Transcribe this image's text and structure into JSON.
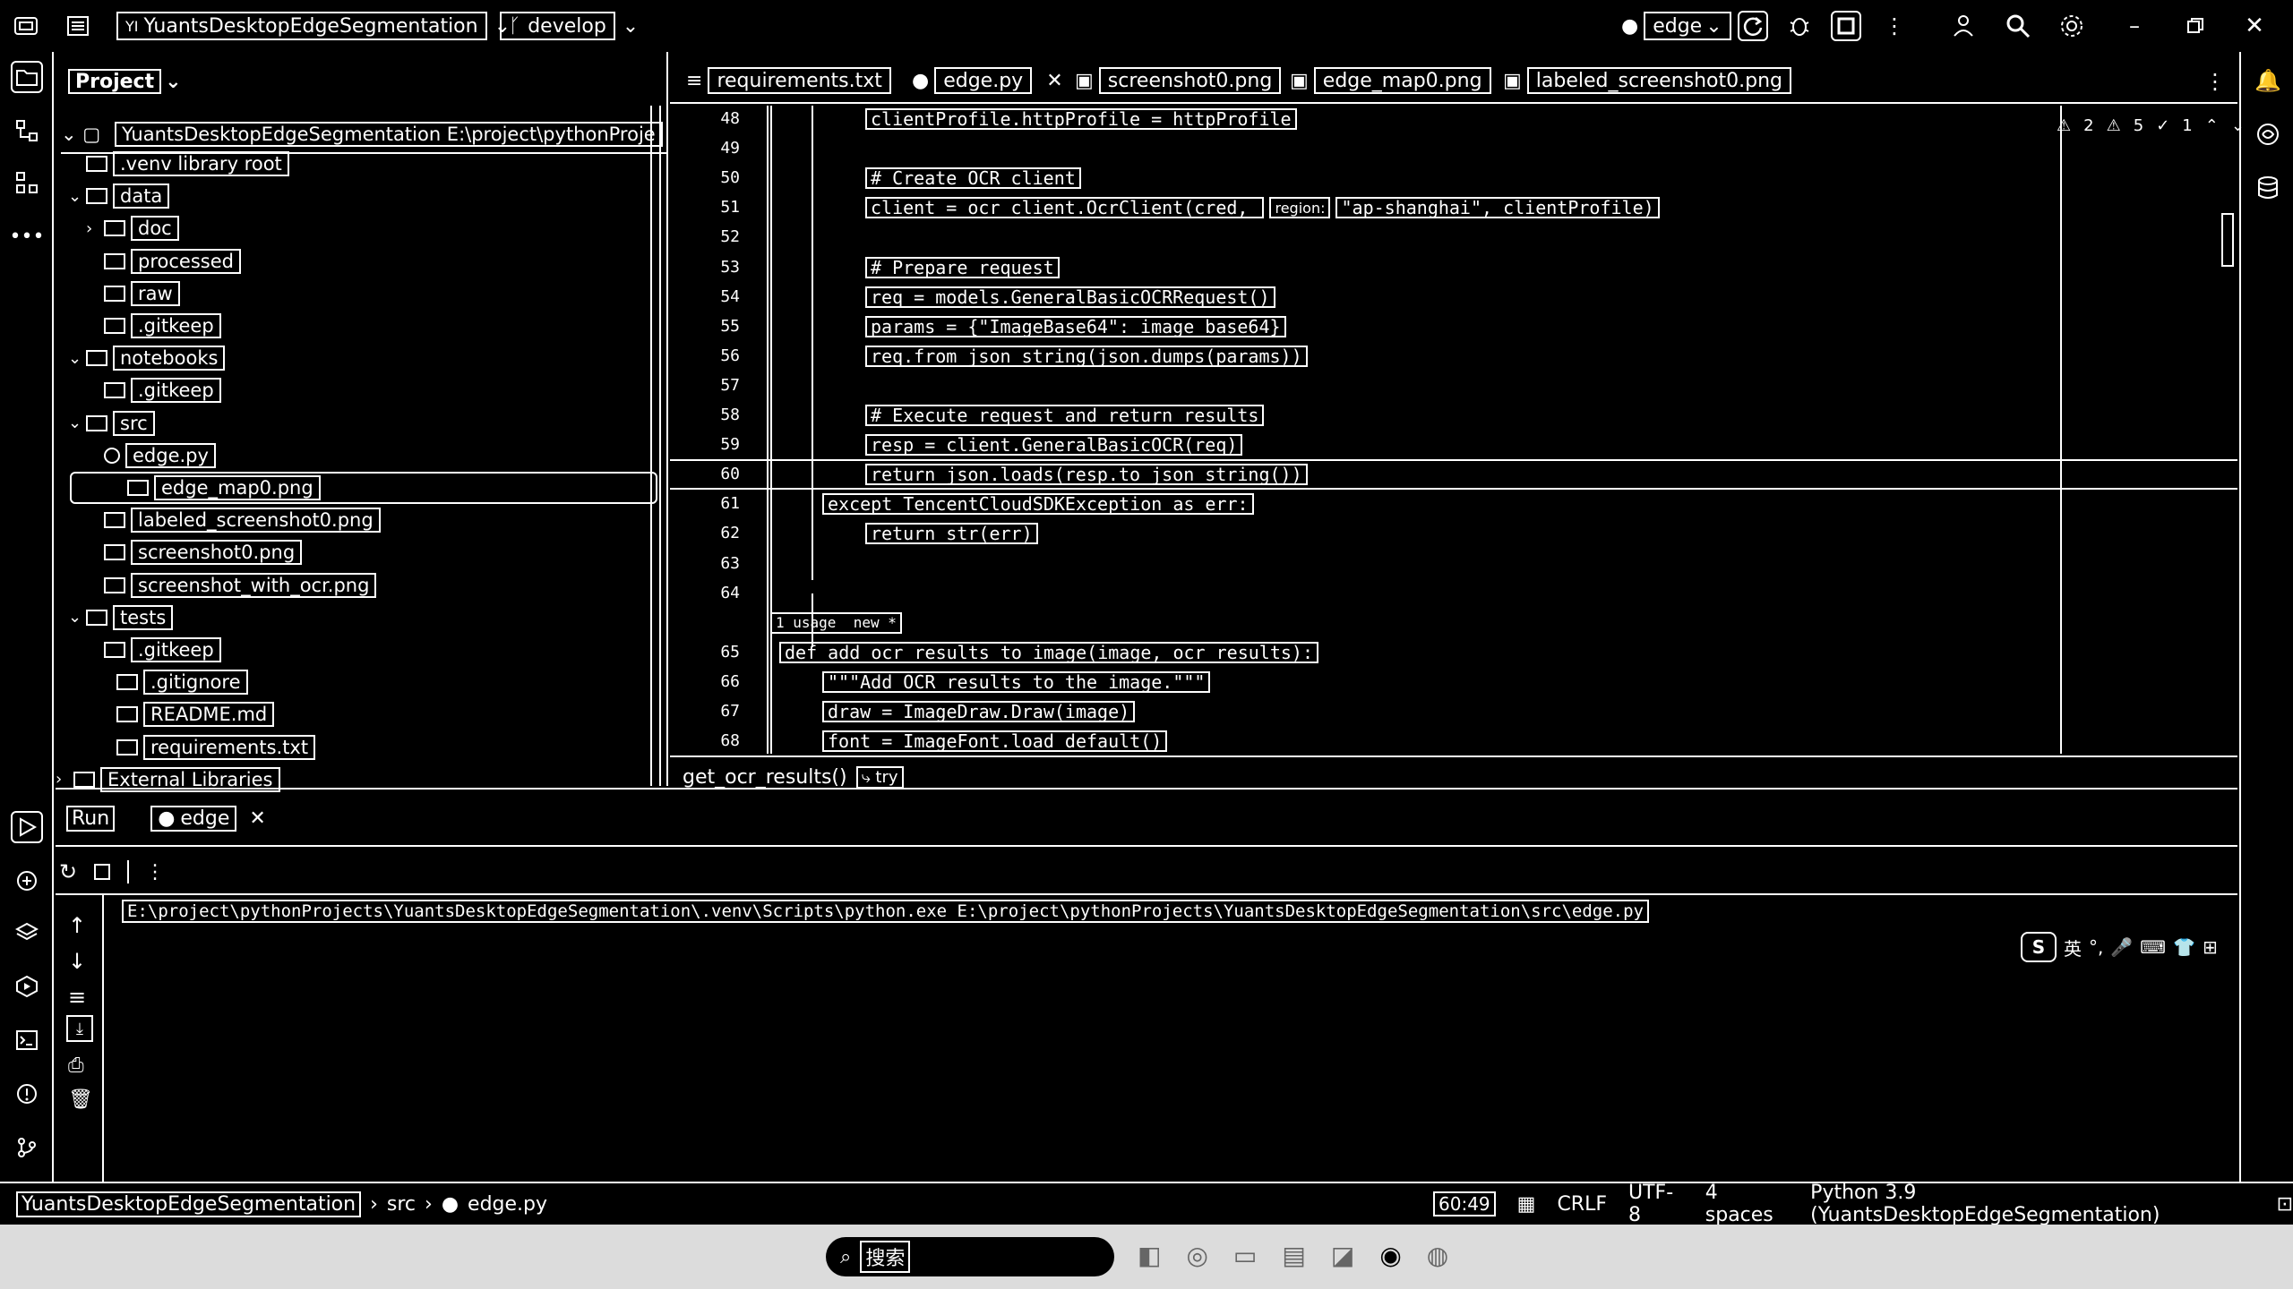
{
  "titlebar": {
    "project_name": "YuantsDesktopEdgeSegmentation",
    "branch": "develop",
    "run_config": "edge"
  },
  "project_panel": {
    "title": "Project",
    "root_label": "YuantsDesktopEdgeSegmentation  E:\\project\\pythonProje",
    "items": [
      {
        "label": ".venv  library root",
        "indent": 0,
        "chev": "",
        "kind": "folder"
      },
      {
        "label": "data",
        "indent": 0,
        "chev": "v",
        "kind": "folder"
      },
      {
        "label": "doc",
        "indent": 1,
        "chev": ">",
        "kind": "folder"
      },
      {
        "label": "processed",
        "indent": 1,
        "chev": "",
        "kind": "folder"
      },
      {
        "label": "raw",
        "indent": 1,
        "chev": "",
        "kind": "folder"
      },
      {
        "label": ".gitkeep",
        "indent": 1,
        "chev": "",
        "kind": "file"
      },
      {
        "label": "notebooks",
        "indent": 0,
        "chev": "v",
        "kind": "folder"
      },
      {
        "label": ".gitkeep",
        "indent": 1,
        "chev": "",
        "kind": "file"
      },
      {
        "label": "src",
        "indent": 0,
        "chev": "v",
        "kind": "folder"
      },
      {
        "label": "edge.py",
        "indent": 1,
        "chev": "",
        "kind": "py"
      },
      {
        "label": "edge_map0.png",
        "indent": 1,
        "chev": "",
        "kind": "img",
        "selected": true
      },
      {
        "label": "labeled_screenshot0.png",
        "indent": 1,
        "chev": "",
        "kind": "img"
      },
      {
        "label": "screenshot0.png",
        "indent": 1,
        "chev": "",
        "kind": "img"
      },
      {
        "label": "screenshot_with_ocr.png",
        "indent": 1,
        "chev": "",
        "kind": "img"
      },
      {
        "label": "tests",
        "indent": 0,
        "chev": "v",
        "kind": "folder"
      },
      {
        "label": ".gitkeep",
        "indent": 1,
        "chev": "",
        "kind": "file"
      },
      {
        "label": ".gitignore",
        "indent": -1,
        "chev": "",
        "kind": "file"
      },
      {
        "label": "README.md",
        "indent": -1,
        "chev": "",
        "kind": "file"
      },
      {
        "label": "requirements.txt",
        "indent": -1,
        "chev": "",
        "kind": "file"
      },
      {
        "label": "External Libraries",
        "indent": -2,
        "chev": ">",
        "kind": "lib"
      }
    ]
  },
  "tabs": [
    {
      "label": "requirements.txt",
      "active": false
    },
    {
      "label": "edge.py",
      "active": true
    },
    {
      "label": "screenshot0.png",
      "active": false
    },
    {
      "label": "edge_map0.png",
      "active": false
    },
    {
      "label": "labeled_screenshot0.png",
      "active": false
    }
  ],
  "inspections": {
    "warnings": "2",
    "weak": "5",
    "typos": "1"
  },
  "code_lines": [
    {
      "n": "48",
      "text": "clientProfile.httpProfile = httpProfile",
      "indent": 2
    },
    {
      "n": "49",
      "text": "",
      "indent": 2
    },
    {
      "n": "50",
      "text": "# Create OCR client",
      "indent": 2
    },
    {
      "n": "51",
      "text": "client = ocr_client.OcrClient(cred, ",
      "indent": 2,
      "hint": "region:",
      "after": "\"ap-shanghai\", clientProfile)"
    },
    {
      "n": "52",
      "text": "",
      "indent": 2
    },
    {
      "n": "53",
      "text": "# Prepare request",
      "indent": 2
    },
    {
      "n": "54",
      "text": "req = models.GeneralBasicOCRRequest()",
      "indent": 2
    },
    {
      "n": "55",
      "text": "params = {\"ImageBase64\": image_base64}",
      "indent": 2
    },
    {
      "n": "56",
      "text": "req.from_json_string(json.dumps(params))",
      "indent": 2
    },
    {
      "n": "57",
      "text": "",
      "indent": 2
    },
    {
      "n": "58",
      "text": "# Execute request and return results",
      "indent": 2
    },
    {
      "n": "59",
      "text": "resp = client.GeneralBasicOCR(req)",
      "indent": 2
    },
    {
      "n": "60",
      "text": "return json.loads(resp.to_json_string())",
      "indent": 2,
      "current": true
    },
    {
      "n": "61",
      "text": "except TencentCloudSDKException as err:",
      "indent": 1
    },
    {
      "n": "62",
      "text": "return str(err)",
      "indent": 2
    },
    {
      "n": "63",
      "text": "",
      "indent": 0
    },
    {
      "n": "64",
      "text": "",
      "indent": 0
    },
    {
      "n": "",
      "text": "1 usage  new *",
      "indent": 0,
      "meta": true
    },
    {
      "n": "65",
      "text": "def add_ocr_results_to_image(image, ocr_results):",
      "indent": 0
    },
    {
      "n": "66",
      "text": "\"\"\"Add OCR results to the image.\"\"\"",
      "indent": 1
    },
    {
      "n": "67",
      "text": "draw = ImageDraw.Draw(image)",
      "indent": 1
    },
    {
      "n": "68",
      "text": "font = ImageFont.load_default()",
      "indent": 1
    }
  ],
  "breadcrumb_bar": {
    "func": "get_ocr_results()",
    "block": "try"
  },
  "run_panel": {
    "tab_run": "Run",
    "tab_edge": "edge",
    "command": "E:\\project\\pythonProjects\\YuantsDesktopEdgeSegmentation\\.venv\\Scripts\\python.exe E:\\project\\pythonProjects\\YuantsDesktopEdgeSegmentation\\src\\edge.py"
  },
  "status_bar": {
    "crumb_project": "YuantsDesktopEdgeSegmentation",
    "crumb_src": "src",
    "crumb_file": "edge.py",
    "position": "60:49",
    "line_sep": "CRLF",
    "encoding": "UTF-8",
    "indent": "4 spaces",
    "interpreter": "Python 3.9 (YuantsDesktopEdgeSegmentation)"
  },
  "taskbar": {
    "search_placeholder": "搜索"
  }
}
